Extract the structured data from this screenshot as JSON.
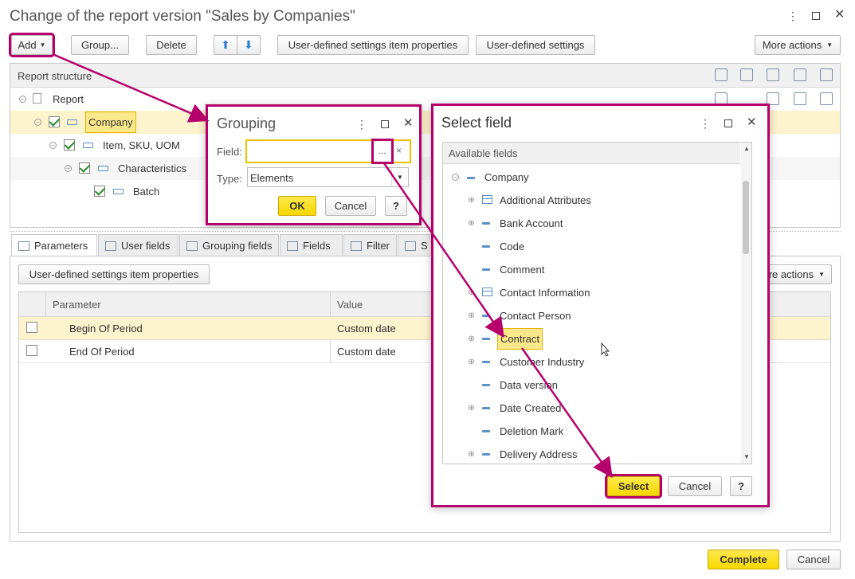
{
  "window": {
    "title": "Change of the report version \"Sales by Companies\""
  },
  "toolbar": {
    "add": "Add",
    "group": "Group...",
    "delete": "Delete",
    "item_props": "User-defined settings item properties",
    "user_settings": "User-defined settings",
    "more_actions": "More actions"
  },
  "structure": {
    "header": "Report structure",
    "rows": [
      {
        "label": "Report"
      },
      {
        "label": "Company"
      },
      {
        "label": "Item, SKU, UOM"
      },
      {
        "label": "Characteristics"
      },
      {
        "label": "Batch"
      }
    ]
  },
  "tabs": [
    "Parameters",
    "User fields",
    "Grouping fields",
    "Fields",
    "Filter",
    "S"
  ],
  "params": {
    "item_props": "User-defined settings item properties",
    "more_actions": "ore actions",
    "columns": [
      "Parameter",
      "Value"
    ],
    "rows": [
      {
        "name": "Begin Of Period",
        "value": "Custom date"
      },
      {
        "name": "End Of Period",
        "value": "Custom date"
      }
    ]
  },
  "grouping": {
    "title": "Grouping",
    "field_label": "Field:",
    "type_label": "Type:",
    "type_value": "Elements",
    "ellipsis": "...",
    "clear": "×",
    "ok": "OK",
    "cancel": "Cancel",
    "help": "?"
  },
  "select_field": {
    "title": "Select field",
    "header": "Available fields",
    "root": "Company",
    "items": [
      {
        "label": "Additional Attributes",
        "icon": "table-icon",
        "expand": true
      },
      {
        "label": "Bank Account",
        "icon": "field-icon",
        "expand": true
      },
      {
        "label": "Code",
        "icon": "field-icon",
        "expand": false
      },
      {
        "label": "Comment",
        "icon": "field-icon",
        "expand": false
      },
      {
        "label": "Contact Information",
        "icon": "table-icon",
        "expand": true
      },
      {
        "label": "Contact Person",
        "icon": "field-icon",
        "expand": true
      },
      {
        "label": "Contract",
        "icon": "field-icon",
        "expand": true
      },
      {
        "label": "Customer Industry",
        "icon": "field-icon",
        "expand": true
      },
      {
        "label": "Data version",
        "icon": "field-icon",
        "expand": false
      },
      {
        "label": "Date Created",
        "icon": "field-icon",
        "expand": true
      },
      {
        "label": "Deletion Mark",
        "icon": "field-icon",
        "expand": false
      },
      {
        "label": "Delivery Address",
        "icon": "field-icon",
        "expand": true
      }
    ],
    "select": "Select",
    "cancel": "Cancel",
    "help": "?"
  },
  "footer": {
    "complete": "Complete",
    "cancel": "Cancel"
  },
  "colors": {
    "accent": "#b5006b",
    "selection": "#fdf3cd",
    "button_yellow": "#f7d700"
  }
}
